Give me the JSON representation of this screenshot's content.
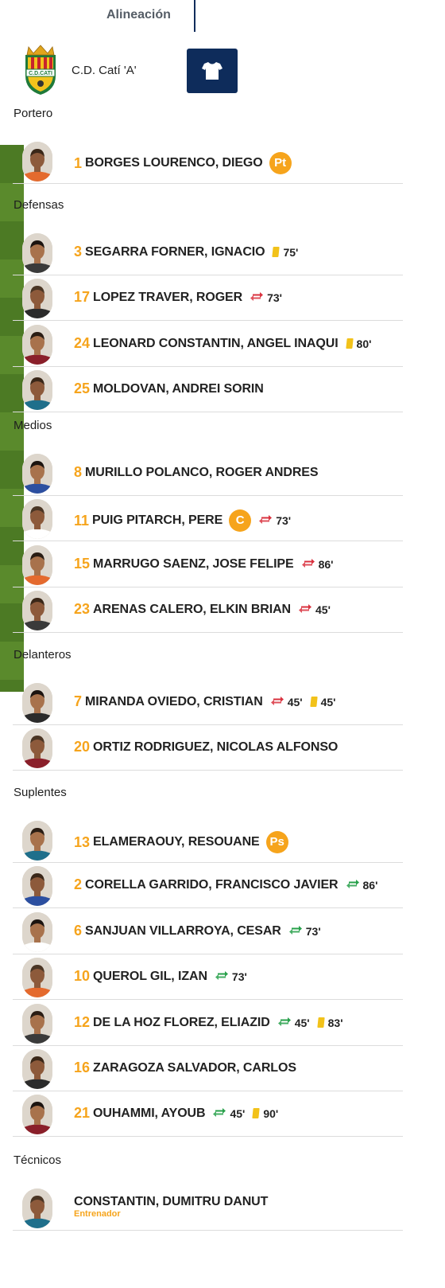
{
  "header": {
    "tab_label": "Alineación"
  },
  "team": {
    "name": "C.D. Catí 'A'",
    "crest_text": "C.D.CATI"
  },
  "colors": {
    "accent": "#f6a41c",
    "navy": "#0e2c5b",
    "green_swap": "#27a04a",
    "red_swap": "#d9313e",
    "yellow_card": "#f2c21a"
  },
  "sections": {
    "goalkeeper": "Portero",
    "defenders": "Defensas",
    "midfielders": "Medios",
    "forwards": "Delanteros",
    "substitutes": "Suplentes",
    "coaches": "Técnicos"
  },
  "goalkeeper": [
    {
      "number": "1",
      "name": "BORGES LOURENCO, DIEGO",
      "badge": "Pt",
      "events": []
    }
  ],
  "defenders": [
    {
      "number": "3",
      "name": "SEGARRA FORNER, IGNACIO",
      "events": [
        {
          "icon": "yellow-card-icon",
          "minute": "75'"
        }
      ]
    },
    {
      "number": "17",
      "name": "LOPEZ TRAVER, ROGER",
      "events": [
        {
          "icon": "substitution-out-icon",
          "minute": "73'"
        }
      ]
    },
    {
      "number": "24",
      "name": "LEONARD CONSTANTIN, ANGEL INAQUI",
      "events": [
        {
          "icon": "yellow-card-icon",
          "minute": "80'"
        }
      ]
    },
    {
      "number": "25",
      "name": "MOLDOVAN, ANDREI SORIN",
      "events": []
    }
  ],
  "midfielders": [
    {
      "number": "8",
      "name": "MURILLO POLANCO, ROGER ANDRES",
      "events": []
    },
    {
      "number": "11",
      "name": "PUIG PITARCH, PERE",
      "badge": "C",
      "events": [
        {
          "icon": "substitution-out-icon",
          "minute": "73'"
        }
      ]
    },
    {
      "number": "15",
      "name": "MARRUGO SAENZ, JOSE FELIPE",
      "events": [
        {
          "icon": "substitution-out-icon",
          "minute": "86'"
        }
      ]
    },
    {
      "number": "23",
      "name": "ARENAS CALERO, ELKIN BRIAN",
      "events": [
        {
          "icon": "substitution-out-icon",
          "minute": "45'"
        }
      ]
    }
  ],
  "forwards": [
    {
      "number": "7",
      "name": "MIRANDA OVIEDO, CRISTIAN",
      "events": [
        {
          "icon": "substitution-out-icon",
          "minute": "45'"
        },
        {
          "icon": "yellow-card-icon",
          "minute": "45'"
        }
      ]
    },
    {
      "number": "20",
      "name": "ORTIZ RODRIGUEZ, NICOLAS ALFONSO",
      "events": []
    }
  ],
  "substitutes": [
    {
      "number": "13",
      "name": "ELAMERAOUY, RESOUANE",
      "badge": "Ps",
      "events": []
    },
    {
      "number": "2",
      "name": "CORELLA GARRIDO, FRANCISCO JAVIER",
      "events": [
        {
          "icon": "substitution-in-icon",
          "minute": "86'"
        }
      ]
    },
    {
      "number": "6",
      "name": "SANJUAN VILLARROYA, CESAR",
      "events": [
        {
          "icon": "substitution-in-icon",
          "minute": "73'"
        }
      ]
    },
    {
      "number": "10",
      "name": "QUEROL GIL, IZAN",
      "events": [
        {
          "icon": "substitution-in-icon",
          "minute": "73'"
        }
      ]
    },
    {
      "number": "12",
      "name": "DE LA HOZ FLOREZ, ELIAZID",
      "events": [
        {
          "icon": "substitution-in-icon",
          "minute": "45'"
        },
        {
          "icon": "yellow-card-icon",
          "minute": "83'"
        }
      ]
    },
    {
      "number": "16",
      "name": "ZARAGOZA SALVADOR, CARLOS",
      "events": []
    },
    {
      "number": "21",
      "name": "OUHAMMI, AYOUB",
      "events": [
        {
          "icon": "substitution-in-icon",
          "minute": "45'"
        },
        {
          "icon": "yellow-card-icon",
          "minute": "90'"
        }
      ]
    }
  ],
  "coaches": [
    {
      "name": "CONSTANTIN, DUMITRU DANUT",
      "role": "Entrenador"
    }
  ]
}
